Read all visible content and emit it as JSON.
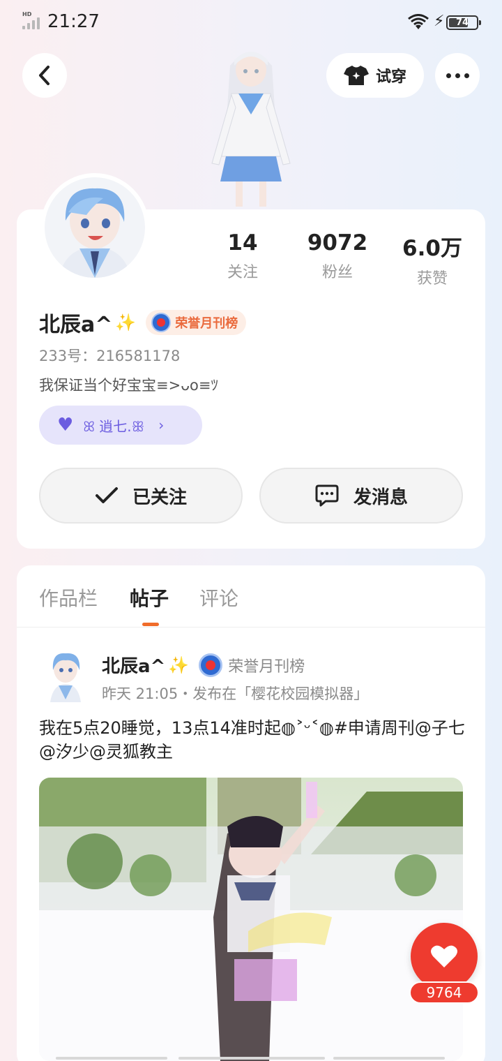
{
  "status_bar": {
    "time": "21:27",
    "network_label": "HD",
    "battery": "74",
    "battery_level": 0.74
  },
  "header": {
    "tryon_label": "试穿"
  },
  "profile": {
    "stats": [
      {
        "value": "14",
        "label": "关注"
      },
      {
        "value": "9072",
        "label": "粉丝"
      },
      {
        "value": "6.0万",
        "label": "获赞"
      }
    ],
    "name": "北辰a^",
    "sparkle": "✨",
    "honor_label": "荣誉月刊榜",
    "uid": "233号：216581178",
    "bio": "我保证当个好宝宝≡>ᴗo≡ﾂ",
    "cp_tag": "ꕤ 逍七.ꕥ",
    "follow_label": "已关注",
    "message_label": "发消息"
  },
  "tabs": [
    {
      "label": "作品栏",
      "active": false
    },
    {
      "label": "帖子",
      "active": true
    },
    {
      "label": "评论",
      "active": false
    }
  ],
  "post": {
    "author": "北辰a^",
    "sparkle": "✨",
    "honor_label": "荣誉月刊榜",
    "meta": "昨天 21:05・发布在「樱花校园模拟器」",
    "text": "我在5点20睡觉，13点14准时起◍˃ᵕ˂◍#申请周刊@子七@汐少@灵狐教主",
    "likes": "9764"
  },
  "colors": {
    "accent": "#f06c2a",
    "like": "#ee3b2f",
    "cp_purple": "#6b5ce0"
  }
}
